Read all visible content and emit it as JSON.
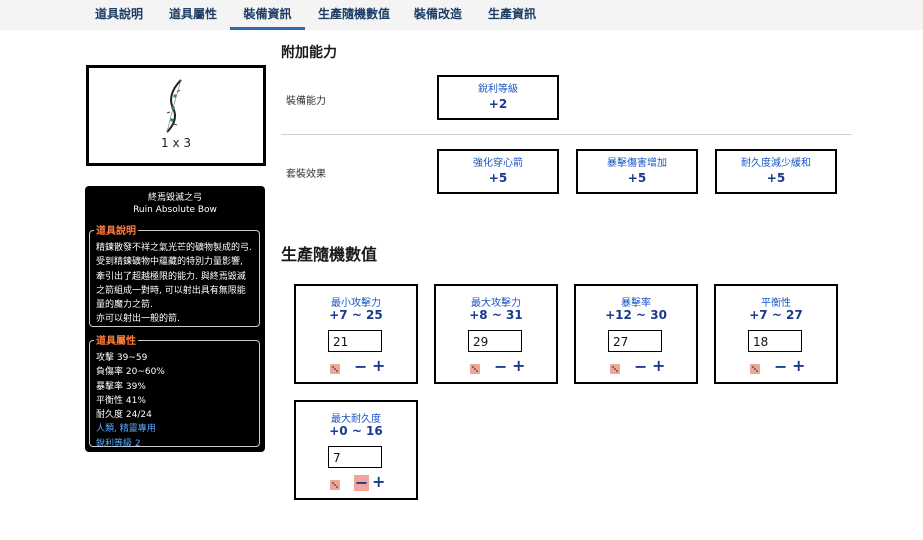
{
  "tabs": [
    {
      "label": "道具說明"
    },
    {
      "label": "道具屬性"
    },
    {
      "label": "裝備資訊"
    },
    {
      "label": "生產隨機數值"
    },
    {
      "label": "裝備改造"
    },
    {
      "label": "生產資訊"
    }
  ],
  "active_tab": "裝備資訊",
  "item_image": {
    "icon": "bow-icon",
    "size": "1 x 3"
  },
  "tooltip": {
    "name_zh": "終焉毀滅之弓",
    "name_en": "Ruin Absolute Bow",
    "desc_header": "道具說明",
    "desc_lines": [
      "精鍊散發不祥之氣光芒的礦物製成的弓.",
      "受到精鍊礦物中蘊藏的特別力量影響,",
      "牽引出了超越極限的能力. 與終焉毀滅",
      "之箭組成一對時, 可以射出具有無限能",
      "量的魔力之箭.",
      "亦可以射出一般的箭."
    ],
    "attr_header": "道具屬性",
    "attrs": [
      "攻擊 39~59",
      "負傷率 20~60%",
      "暴擊率 39%",
      "平衡性 41%",
      "耐久度 24/24"
    ],
    "attrs_blue": [
      "人類, 精靈專用",
      "銳利等級 2"
    ],
    "blue_color": "#5aa9ff",
    "header_color": "#ff7a3a"
  },
  "additional": {
    "title": "附加能力",
    "equip_label": "裝備能力",
    "equip_stats": [
      {
        "name": "銳利等級",
        "value": "+2"
      }
    ],
    "set_label": "套裝效果",
    "set_stats": [
      {
        "name": "強化穿心箭",
        "value": "+5"
      },
      {
        "name": "暴擊傷害增加",
        "value": "+5"
      },
      {
        "name": "耐久度減少緩和",
        "value": "+5"
      }
    ]
  },
  "random": {
    "title": "生產隨機數值",
    "cards": [
      {
        "name": "最小攻擊力",
        "range": "+7 ~ 25",
        "value": "21"
      },
      {
        "name": "最大攻擊力",
        "range": "+8 ~ 31",
        "value": "29"
      },
      {
        "name": "暴擊率",
        "range": "+12 ~ 30",
        "value": "27"
      },
      {
        "name": "平衡性",
        "range": "+7 ~ 27",
        "value": "18"
      },
      {
        "name": "最大耐久度",
        "range": "+0 ~ 16",
        "value": "7"
      }
    ],
    "minus_symbol": "−",
    "plus_symbol": "+"
  },
  "colors": {
    "accent": "#2b6cb0",
    "name_blue": "#1a56c5",
    "value_navy": "#1a3a8c"
  }
}
